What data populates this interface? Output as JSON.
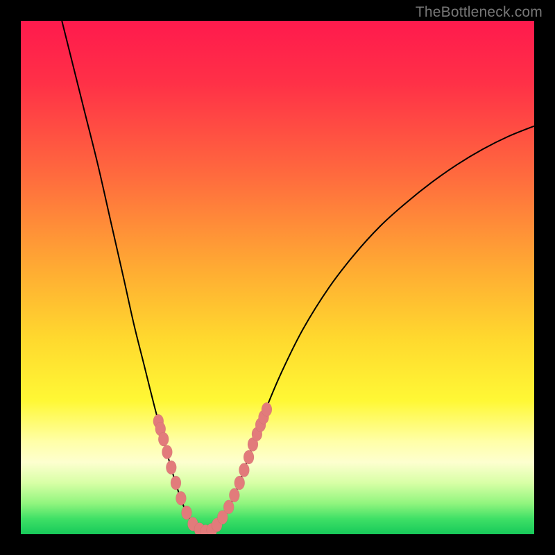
{
  "watermark": "TheBottleneck.com",
  "chart_data": {
    "type": "line",
    "title": "",
    "xlabel": "",
    "ylabel": "",
    "xlim": [
      0,
      100
    ],
    "ylim": [
      0,
      100
    ],
    "gradient": {
      "direction": "top-to-bottom",
      "stops": [
        {
          "pos": 0.0,
          "color": "#ff1a4d"
        },
        {
          "pos": 0.12,
          "color": "#ff3047"
        },
        {
          "pos": 0.3,
          "color": "#ff6a3e"
        },
        {
          "pos": 0.48,
          "color": "#ffaa33"
        },
        {
          "pos": 0.62,
          "color": "#ffd92e"
        },
        {
          "pos": 0.74,
          "color": "#fff835"
        },
        {
          "pos": 0.82,
          "color": "#ffffa8"
        },
        {
          "pos": 0.86,
          "color": "#fdffcf"
        },
        {
          "pos": 0.9,
          "color": "#d8ffa6"
        },
        {
          "pos": 0.94,
          "color": "#91f57e"
        },
        {
          "pos": 0.97,
          "color": "#3fe066"
        },
        {
          "pos": 1.0,
          "color": "#17c95a"
        }
      ]
    },
    "series": [
      {
        "name": "left-curve",
        "type": "line",
        "points": [
          {
            "x": 8.0,
            "y": 100.0
          },
          {
            "x": 10.0,
            "y": 92.0
          },
          {
            "x": 12.5,
            "y": 82.0
          },
          {
            "x": 15.0,
            "y": 72.0
          },
          {
            "x": 17.5,
            "y": 61.0
          },
          {
            "x": 20.0,
            "y": 50.0
          },
          {
            "x": 22.0,
            "y": 41.0
          },
          {
            "x": 24.0,
            "y": 33.0
          },
          {
            "x": 26.0,
            "y": 25.0
          },
          {
            "x": 28.0,
            "y": 17.5
          },
          {
            "x": 30.0,
            "y": 10.5
          },
          {
            "x": 31.5,
            "y": 6.0
          },
          {
            "x": 33.0,
            "y": 2.8
          },
          {
            "x": 34.5,
            "y": 1.0
          },
          {
            "x": 36.0,
            "y": 0.5
          }
        ]
      },
      {
        "name": "right-curve",
        "type": "line",
        "points": [
          {
            "x": 36.0,
            "y": 0.5
          },
          {
            "x": 38.0,
            "y": 1.5
          },
          {
            "x": 40.0,
            "y": 4.0
          },
          {
            "x": 42.0,
            "y": 8.5
          },
          {
            "x": 44.0,
            "y": 14.0
          },
          {
            "x": 46.0,
            "y": 19.5
          },
          {
            "x": 48.0,
            "y": 25.0
          },
          {
            "x": 51.0,
            "y": 32.0
          },
          {
            "x": 55.0,
            "y": 40.0
          },
          {
            "x": 60.0,
            "y": 48.0
          },
          {
            "x": 65.0,
            "y": 54.5
          },
          {
            "x": 70.0,
            "y": 60.0
          },
          {
            "x": 75.0,
            "y": 64.5
          },
          {
            "x": 80.0,
            "y": 68.5
          },
          {
            "x": 85.0,
            "y": 72.0
          },
          {
            "x": 90.0,
            "y": 75.0
          },
          {
            "x": 95.0,
            "y": 77.5
          },
          {
            "x": 100.0,
            "y": 79.5
          }
        ]
      },
      {
        "name": "left-markers",
        "type": "scatter",
        "marker_color": "#e27b7b",
        "points": [
          {
            "x": 26.8,
            "y": 22.0
          },
          {
            "x": 27.2,
            "y": 20.5
          },
          {
            "x": 27.8,
            "y": 18.5
          },
          {
            "x": 28.5,
            "y": 16.0
          },
          {
            "x": 29.3,
            "y": 13.0
          },
          {
            "x": 30.2,
            "y": 10.0
          },
          {
            "x": 31.2,
            "y": 7.0
          },
          {
            "x": 32.3,
            "y": 4.2
          },
          {
            "x": 33.5,
            "y": 2.0
          },
          {
            "x": 34.8,
            "y": 0.9
          },
          {
            "x": 36.0,
            "y": 0.5
          }
        ]
      },
      {
        "name": "right-markers",
        "type": "scatter",
        "marker_color": "#e27b7b",
        "points": [
          {
            "x": 37.2,
            "y": 0.8
          },
          {
            "x": 38.2,
            "y": 1.8
          },
          {
            "x": 39.3,
            "y": 3.3
          },
          {
            "x": 40.5,
            "y": 5.3
          },
          {
            "x": 41.6,
            "y": 7.6
          },
          {
            "x": 42.6,
            "y": 10.0
          },
          {
            "x": 43.5,
            "y": 12.5
          },
          {
            "x": 44.4,
            "y": 15.0
          },
          {
            "x": 45.2,
            "y": 17.5
          },
          {
            "x": 46.0,
            "y": 19.5
          },
          {
            "x": 46.7,
            "y": 21.3
          },
          {
            "x": 47.3,
            "y": 22.8
          },
          {
            "x": 47.9,
            "y": 24.3
          }
        ]
      }
    ]
  }
}
